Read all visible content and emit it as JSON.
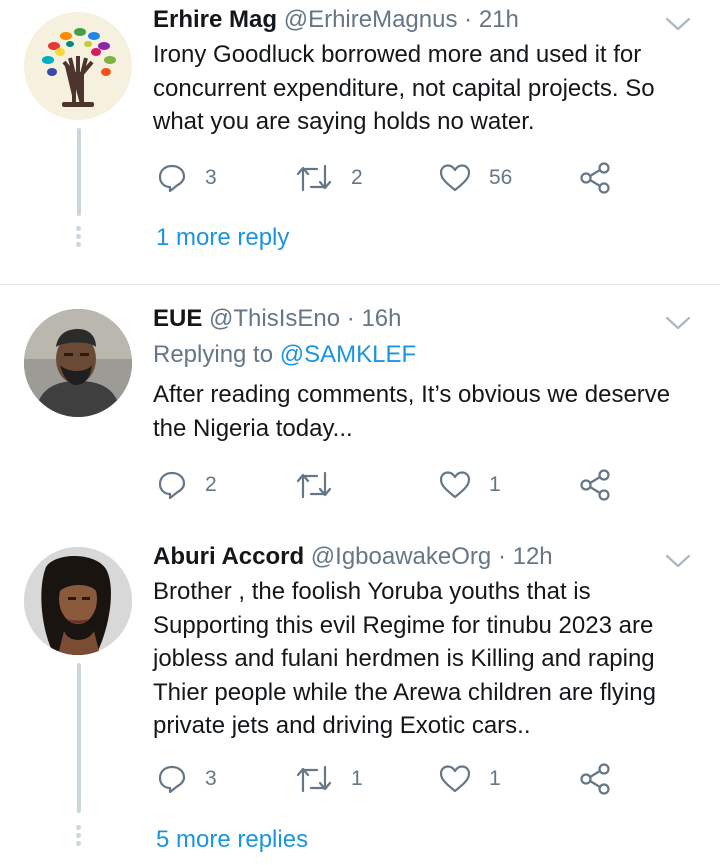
{
  "tweets": [
    {
      "name": "Erhire Mag",
      "handle": "@ErhireMagnus",
      "sep": "·",
      "time": "21h",
      "body": "Irony Goodluck borrowed more and used it for concurrent expenditure, not capital projects. So what you are saying holds no water.",
      "replies": "3",
      "retweets": "2",
      "likes": "56",
      "more_replies": "1 more reply",
      "avatar": "tree-of-hands-logo"
    },
    {
      "name": "EUE",
      "handle": "@ThisIsEno",
      "sep": "·",
      "time": "16h",
      "replying_prefix": "Replying to ",
      "replying_to": "@SAMKLEF",
      "body": "After reading comments, It’s obvious we deserve the Nigeria today...",
      "replies": "2",
      "retweets": "",
      "likes": "1",
      "avatar": "man-with-beard-photo"
    },
    {
      "name": "Aburi Accord",
      "handle": "@IgboawakeOrg",
      "sep": "·",
      "time": "12h",
      "body": "Brother , the foolish Yoruba youths that is Supporting this evil Regime for tinubu 2023 are jobless and fulani herdmen is Killing and raping Thier people while the Arewa children are flying private jets and driving Exotic cars..",
      "replies": "3",
      "retweets": "1",
      "likes": "1",
      "more_replies": "5 more replies",
      "avatar": "woman-portrait-photo"
    }
  ],
  "colors": {
    "text": "#14171a",
    "secondary": "#657786",
    "link": "#1b95e0",
    "thread": "#ccd6dd"
  },
  "icons": [
    "reply-icon",
    "retweet-icon",
    "like-icon",
    "share-icon",
    "chevron-down-icon"
  ]
}
